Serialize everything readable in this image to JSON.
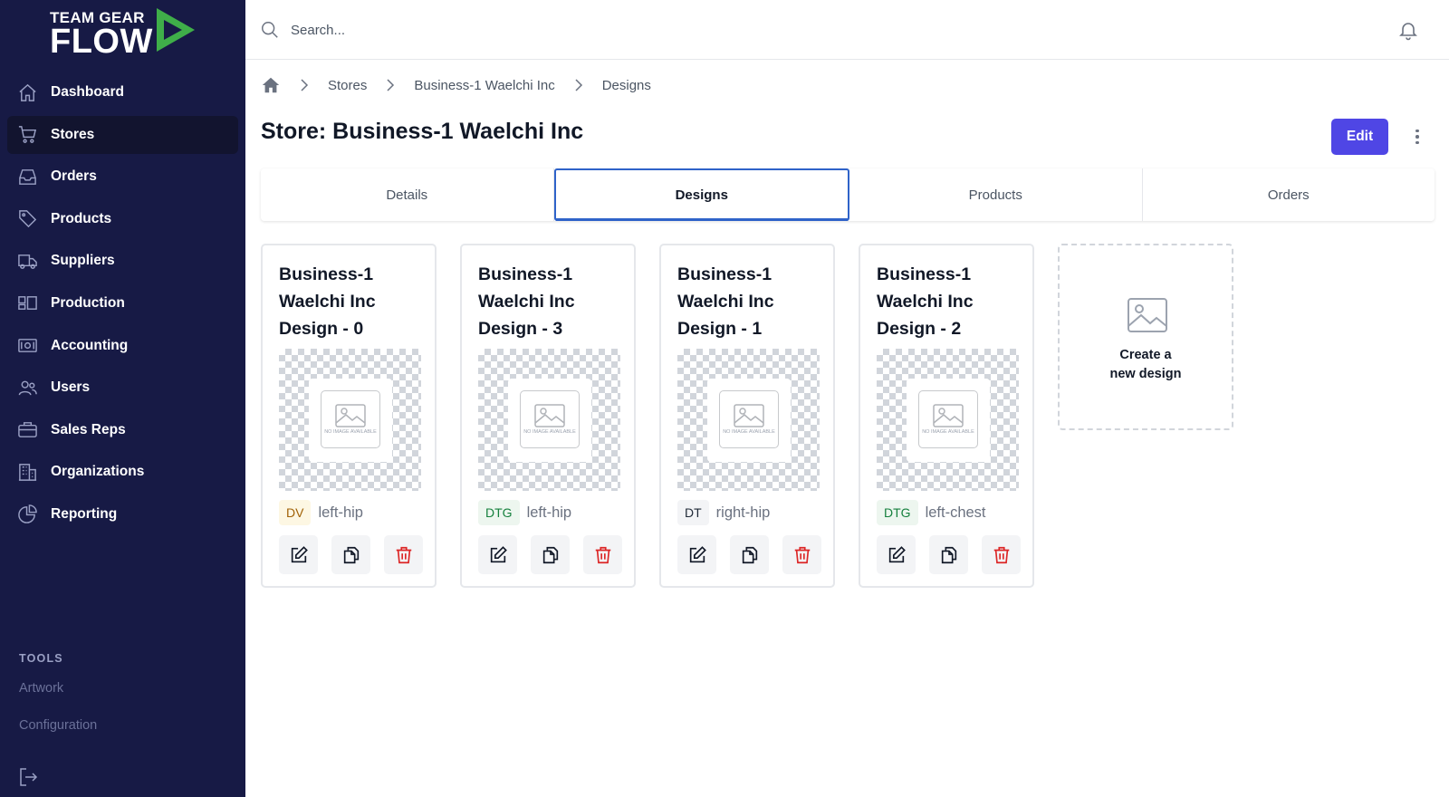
{
  "app": {
    "logo_top": "TEAM GEAR",
    "logo_bottom": "FLOW"
  },
  "sidebar": {
    "items": [
      {
        "label": "Dashboard",
        "icon": "home-icon"
      },
      {
        "label": "Stores",
        "icon": "cart-icon",
        "active": true
      },
      {
        "label": "Orders",
        "icon": "inbox-icon"
      },
      {
        "label": "Products",
        "icon": "tag-icon"
      },
      {
        "label": "Suppliers",
        "icon": "truck-icon"
      },
      {
        "label": "Production",
        "icon": "production-icon"
      },
      {
        "label": "Accounting",
        "icon": "cash-icon"
      },
      {
        "label": "Users",
        "icon": "users-icon"
      },
      {
        "label": "Sales Reps",
        "icon": "briefcase-icon"
      },
      {
        "label": "Organizations",
        "icon": "building-icon"
      },
      {
        "label": "Reporting",
        "icon": "pie-chart-icon"
      }
    ],
    "tools_heading": "TOOLS",
    "tools": [
      "Artwork",
      "Configuration"
    ]
  },
  "search": {
    "placeholder": "Search..."
  },
  "breadcrumb": [
    "Stores",
    "Business-1 Waelchi Inc",
    "Designs"
  ],
  "page": {
    "title": "Store: Business-1 Waelchi Inc",
    "edit_label": "Edit"
  },
  "tabs": [
    {
      "label": "Details"
    },
    {
      "label": "Designs",
      "active": true
    },
    {
      "label": "Products"
    },
    {
      "label": "Orders"
    }
  ],
  "designs": [
    {
      "title": "Business-1 Waelchi Inc Design - 0",
      "method": "DV",
      "location": "left-hip"
    },
    {
      "title": "Business-1 Waelchi Inc Design - 3",
      "method": "DTG",
      "location": "left-hip"
    },
    {
      "title": "Business-1 Waelchi Inc Design - 1",
      "method": "DT",
      "location": "right-hip"
    },
    {
      "title": "Business-1 Waelchi Inc Design - 2",
      "method": "DTG",
      "location": "left-chest"
    }
  ],
  "no_image_text": "NO IMAGE AVAILABLE",
  "create_design": {
    "label": "Create a\nnew design"
  },
  "colors": {
    "sidebar_bg": "#171a45",
    "accent": "#4f46e5",
    "logo_green": "#3fae49",
    "delete_red": "#dc2626",
    "active_tab_border": "#2f63c9"
  }
}
